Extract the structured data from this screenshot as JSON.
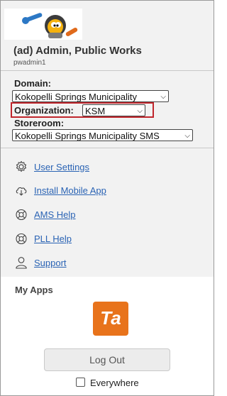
{
  "user": {
    "display_name": "(ad) Admin, Public Works",
    "login": "pwadmin1"
  },
  "domain": {
    "label": "Domain:",
    "value": "Kokopelli Springs Municipality"
  },
  "organization": {
    "label": "Organization:",
    "value": "KSM"
  },
  "storeroom": {
    "label": "Storeroom:",
    "value": "Kokopelli Springs Municipality SMS"
  },
  "menu": [
    {
      "label": "User Settings",
      "icon": "gear-icon"
    },
    {
      "label": "Install Mobile App",
      "icon": "cloud-download-icon"
    },
    {
      "label": "AMS Help",
      "icon": "lifebuoy-icon"
    },
    {
      "label": "PLL Help",
      "icon": "lifebuoy-icon"
    },
    {
      "label": "Support",
      "icon": "person-icon"
    }
  ],
  "apps": {
    "heading": "My Apps",
    "ta_label": "Ta"
  },
  "actions": {
    "logout_label": "Log Out",
    "everywhere_label": "Everywhere",
    "everywhere_checked": false
  },
  "colors": {
    "link": "#2a63b4",
    "app_tile": "#e8731b",
    "highlight": "#c0262c"
  }
}
